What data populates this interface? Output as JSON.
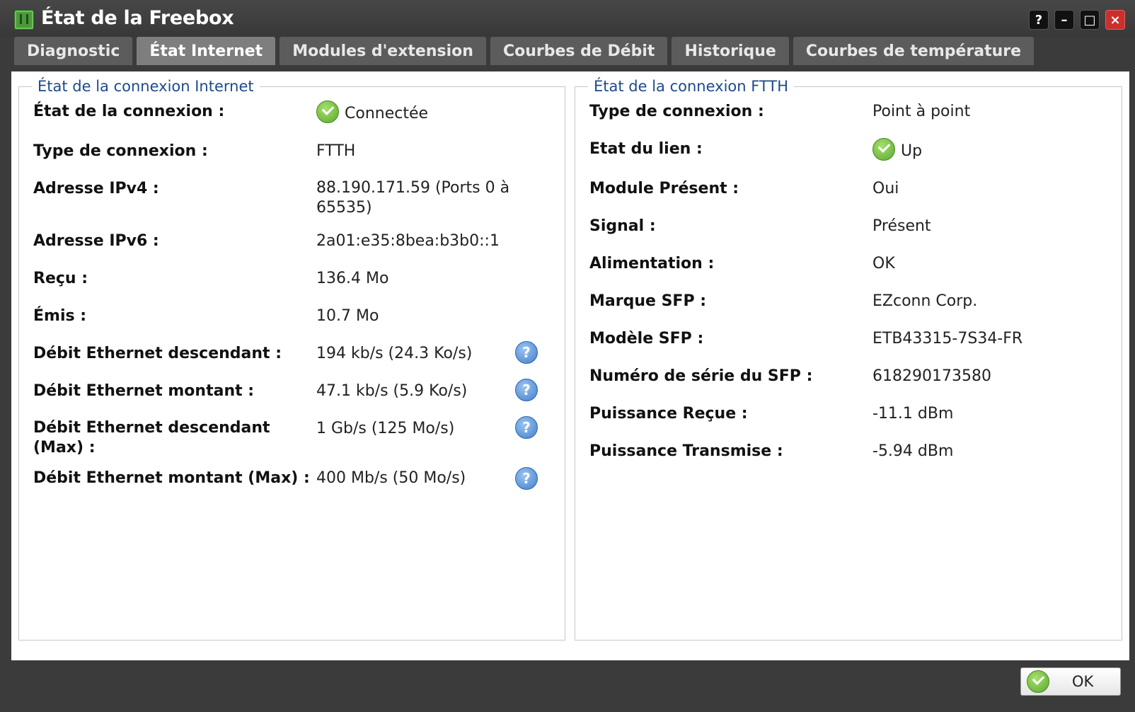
{
  "window": {
    "title": "État de la Freebox",
    "buttons": [
      "?",
      "–",
      "□",
      "×"
    ]
  },
  "tabs": [
    {
      "label": "Diagnostic",
      "active": false
    },
    {
      "label": "État Internet",
      "active": true
    },
    {
      "label": "Modules d'extension",
      "active": false
    },
    {
      "label": "Courbes de Débit",
      "active": false
    },
    {
      "label": "Historique",
      "active": false
    },
    {
      "label": "Courbes de température",
      "active": false
    }
  ],
  "internet": {
    "legend": "État de la connexion Internet",
    "rows": [
      {
        "label": "État de la connexion :",
        "value": "Connectée"
      },
      {
        "label": "Type de connexion :",
        "value": "FTTH"
      },
      {
        "label": "Adresse IPv4 :",
        "value": "88.190.171.59 (Ports 0 à 65535)"
      },
      {
        "label": "Adresse IPv6 :",
        "value": "2a01:e35:8bea:b3b0::1"
      },
      {
        "label": "Reçu :",
        "value": "136.4 Mo"
      },
      {
        "label": "Émis :",
        "value": "10.7 Mo"
      },
      {
        "label": "Débit Ethernet descendant :",
        "value": "194 kb/s (24.3 Ko/s)"
      },
      {
        "label": "Débit Ethernet montant :",
        "value": "47.1 kb/s (5.9 Ko/s)"
      },
      {
        "label": "Débit Ethernet descendant (Max) :",
        "value": "1 Gb/s (125 Mo/s)"
      },
      {
        "label": "Débit Ethernet montant (Max) :",
        "value": "400 Mb/s (50 Mo/s)"
      }
    ]
  },
  "ftth": {
    "legend": "État de la connexion FTTH",
    "rows": [
      {
        "label": "Type de connexion :",
        "value": "Point à point"
      },
      {
        "label": "Etat du lien :",
        "value": "Up"
      },
      {
        "label": "Module Présent :",
        "value": "Oui"
      },
      {
        "label": "Signal :",
        "value": "Présent"
      },
      {
        "label": "Alimentation :",
        "value": "OK"
      },
      {
        "label": "Marque SFP :",
        "value": "EZconn Corp."
      },
      {
        "label": "Modèle SFP :",
        "value": "ETB43315-7S34-FR"
      },
      {
        "label": "Numéro de série du SFP :",
        "value": "618290173580"
      },
      {
        "label": "Puissance Reçue :",
        "value": "-11.1 dBm"
      },
      {
        "label": "Puissance Transmise :",
        "value": "-5.94 dBm"
      }
    ]
  },
  "footer": {
    "ok_label": "OK"
  },
  "icons": {
    "status_ok": "check-circle-icon",
    "help": "help-icon"
  },
  "colors": {
    "legend": "#1e4a8c",
    "check_green": "#5aa82d",
    "help_blue": "#3f7fcc"
  }
}
